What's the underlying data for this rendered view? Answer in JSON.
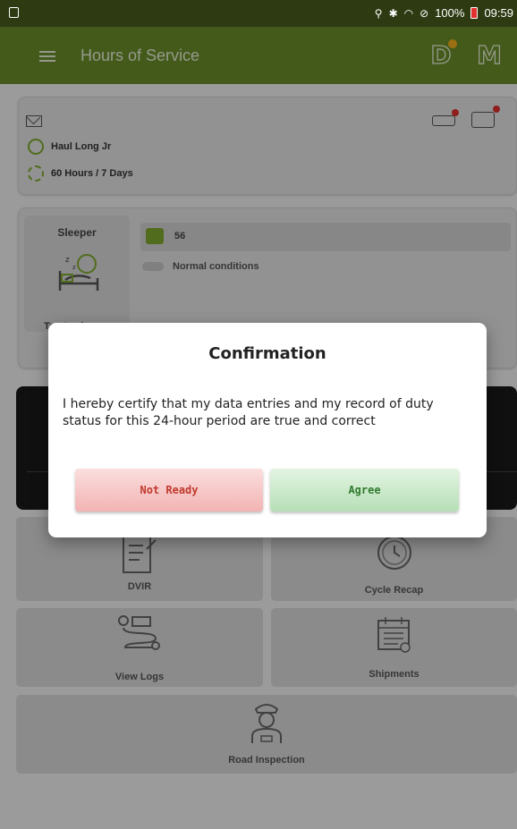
{
  "status_bar": {
    "battery": "100%",
    "time": "09:59",
    "icons": [
      "notification-icon",
      "location-icon",
      "bluetooth-icon",
      "wifi-icon",
      "no-sim-icon",
      "battery-icon"
    ]
  },
  "app_bar": {
    "title": "Hours of Service",
    "badge_d": "D",
    "badge_m": "M"
  },
  "driver": {
    "name": "Haul Long Jr",
    "cycle": "60 Hours / 7 Days"
  },
  "status": {
    "current": "Sleeper",
    "tap_hint": "Tap to change",
    "vehicle": "56",
    "condition": "Normal conditions"
  },
  "menu": {
    "dvir": "DVIR",
    "cycle_recap": "Cycle Recap",
    "view_logs": "View Logs",
    "shipments": "Shipments",
    "road_inspection": "Road Inspection"
  },
  "dialog": {
    "title": "Confirmation",
    "message": "I hereby certify that my data entries and my record of duty status for this 24-hour period are true and correct",
    "not_ready_label": "Not Ready",
    "agree_label": "Agree"
  },
  "colors": {
    "app_bar": "#6a8e2a",
    "status_bar": "#2d3a12",
    "accent": "#7faa2c",
    "alert_red": "#e03131",
    "not_ready_text": "#c0392b",
    "agree_text": "#2f7a2f"
  }
}
